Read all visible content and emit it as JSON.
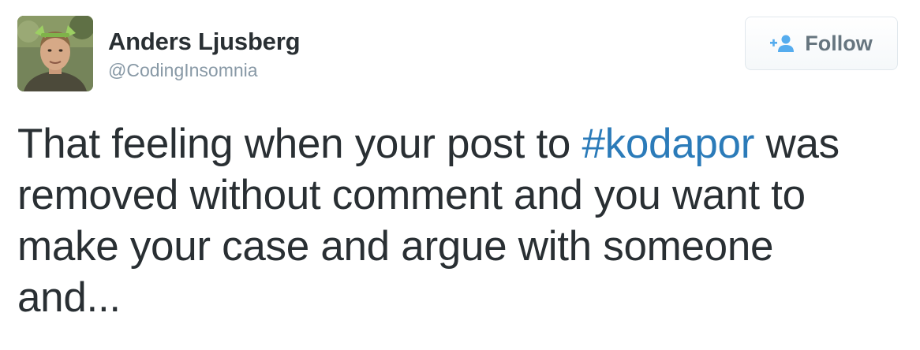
{
  "author": {
    "display_name": "Anders Ljusberg",
    "username": "@CodingInsomnia",
    "avatar_icon": "user-avatar-photo"
  },
  "follow_button": {
    "label": "Follow",
    "icon": "add-user-icon"
  },
  "tweet": {
    "line1_before": "That feeling when your post to ",
    "hashtag": "#kodapor",
    "line1_after": " was",
    "line2": "removed without comment and you want to",
    "line3": "make your case and argue with someone",
    "line4": "and..."
  },
  "colors": {
    "text": "#292f33",
    "muted": "#8899a6",
    "hashtag": "#2b7bb9",
    "follow_icon": "#55acee"
  }
}
